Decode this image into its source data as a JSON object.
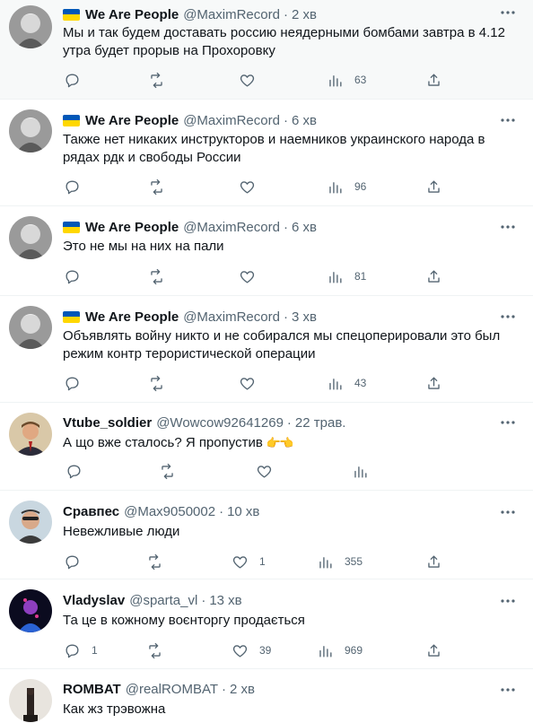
{
  "tweets": [
    {
      "name": "We Are People",
      "handle": "@MaximRecord",
      "time": "2 хв",
      "text": "Мы и так будем доставать россию неядерными бомбами завтра в 4.12 утра будет прорыв на Прохоровку",
      "reply_count": "",
      "like_count": "",
      "view_count": "63"
    },
    {
      "name": "We Are People",
      "handle": "@MaximRecord",
      "time": "6 хв",
      "text": "Также нет никаких инструкторов и наемников украинского народа в рядах рдк и свободы России",
      "reply_count": "",
      "like_count": "",
      "view_count": "96"
    },
    {
      "name": "We Are People",
      "handle": "@MaximRecord",
      "time": "6 хв",
      "text": "Это не мы на них на пали",
      "reply_count": "",
      "like_count": "",
      "view_count": "81"
    },
    {
      "name": "We Are People",
      "handle": "@MaximRecord",
      "time": "3 хв",
      "text": "Объявлять войну никто и не собирался мы спецоперировали это был режим контр терористической операции",
      "reply_count": "",
      "like_count": "",
      "view_count": "43"
    },
    {
      "name": "Vtube_soldier",
      "handle": "@Wowcow92641269",
      "time": "22 трав.",
      "text": "А що вже сталось? Я пропустив",
      "reply_count": "",
      "like_count": "",
      "view_count": ""
    },
    {
      "name": "Сравпес",
      "handle": "@Max9050002",
      "time": "10 хв",
      "text": "Невежливые люди",
      "reply_count": "",
      "like_count": "1",
      "view_count": "355"
    },
    {
      "name": "Vladyslav",
      "handle": "@sparta_vl",
      "time": "13 хв",
      "text": "Та це в кожному воєнторгу продається",
      "reply_count": "1",
      "like_count": "39",
      "view_count": "969"
    },
    {
      "name": "ROMBAT",
      "handle": "@realROMBAT",
      "time": "2 хв",
      "text": "Как жз трэвожна",
      "reply_count": "",
      "like_count": "",
      "view_count": ""
    }
  ],
  "icons": {
    "verified_flag": "ukraine-flag-icon",
    "reply": "reply-icon",
    "retweet": "retweet-icon",
    "like": "heart-icon",
    "views": "views-chart-icon",
    "share": "share-icon",
    "more": "more-icon"
  },
  "colors": {
    "text": "#0f1419",
    "secondary": "#536471",
    "divider": "#eff3f4",
    "highlight_bg": "#f7f9f9",
    "flag_blue": "#0057b7",
    "flag_yellow": "#ffd700"
  }
}
